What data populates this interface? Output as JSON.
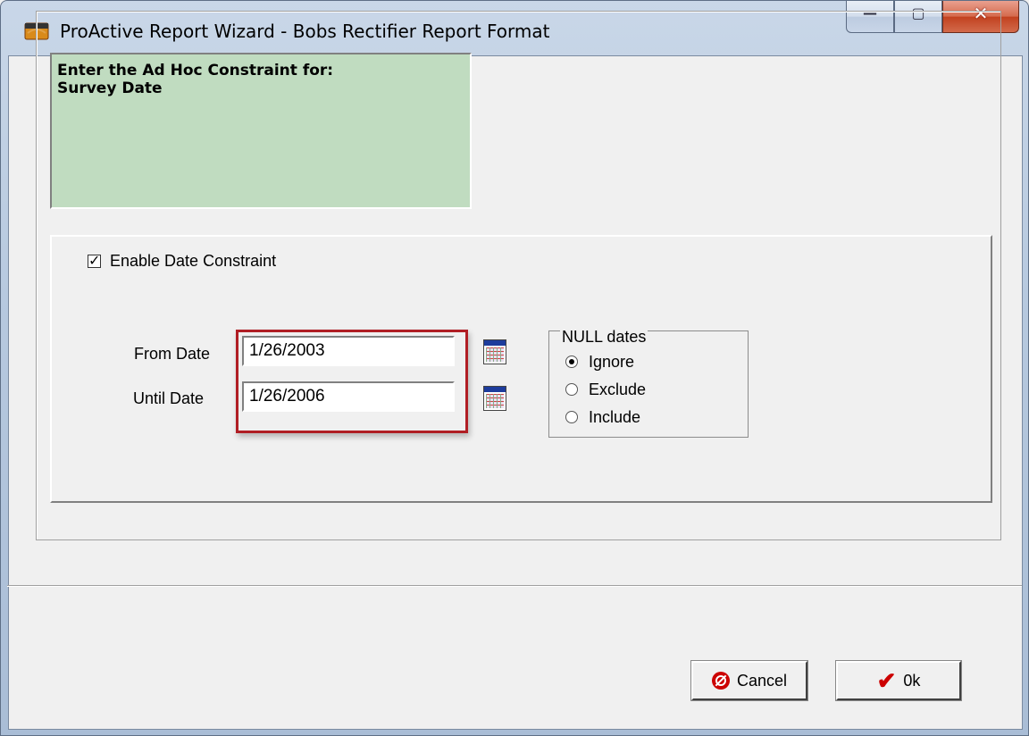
{
  "window": {
    "title": "ProActive Report Wizard - Bobs Rectifier Report Format",
    "minimize_glyph": "—",
    "maximize_glyph": "▢",
    "close_glyph": "✕"
  },
  "prompt": {
    "line1": "Enter the Ad Hoc Constraint for:",
    "line2": "Survey Date"
  },
  "constraint": {
    "enable_label": "Enable Date Constraint",
    "enabled": true,
    "from_label": "From Date",
    "from_value": "1/26/2003",
    "until_label": "Until Date",
    "until_value": "1/26/2006"
  },
  "null_dates": {
    "legend": "NULL dates",
    "options": [
      "Ignore",
      "Exclude",
      "Include"
    ],
    "selected": "Ignore"
  },
  "buttons": {
    "cancel": "Cancel",
    "ok": "0k"
  },
  "colors": {
    "prompt_bg": "#c0dcc0",
    "highlight": "#b01e24",
    "close_button": "#c8462a"
  }
}
